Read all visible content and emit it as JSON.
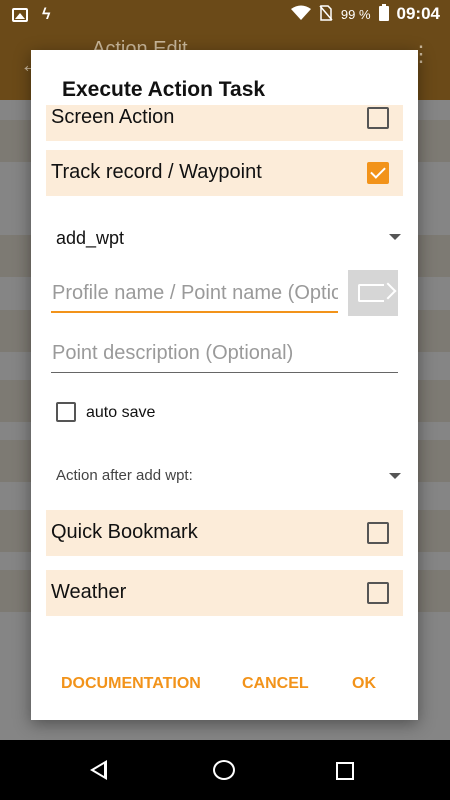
{
  "statusbar": {
    "battery": "99 %",
    "time": "09:04"
  },
  "background": {
    "title": "Action Edit"
  },
  "dialog": {
    "title": "Execute Action Task",
    "rows": [
      {
        "label": "Screen Action",
        "checked": false
      },
      {
        "label": "Track record / Waypoint",
        "checked": true
      }
    ],
    "action_select": {
      "value": "add_wpt"
    },
    "profile_field": {
      "value": "",
      "placeholder": "Profile name / Point name (Optional)"
    },
    "description_field": {
      "value": "",
      "placeholder": "Point description (Optional)"
    },
    "auto_save": {
      "label": "auto save",
      "checked": false
    },
    "after_select": {
      "value": "Action after add wpt:"
    },
    "more_rows": [
      {
        "label": "Quick Bookmark",
        "checked": false
      },
      {
        "label": "Weather",
        "checked": false
      }
    ],
    "buttons": {
      "documentation": "DOCUMENTATION",
      "cancel": "CANCEL",
      "ok": "OK"
    }
  },
  "colors": {
    "accent": "#f2931a",
    "row_bg": "#fcecd9",
    "appbar": "#6b4a18"
  }
}
